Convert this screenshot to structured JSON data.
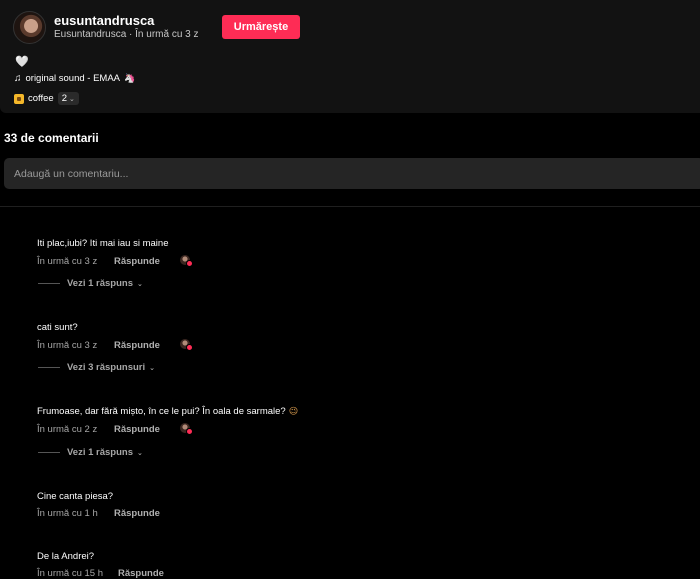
{
  "post": {
    "author_name": "eusuntandrusca",
    "author_meta": "Eusuntandrusca · În urmă cu 3 z",
    "follow_label": "Urmărește",
    "heart_glyph": "🤍",
    "sound_label": "original sound - EMAA",
    "sound_emoji": "🦄",
    "tag_label": "coffee",
    "tag_count": "2"
  },
  "comments_section": {
    "title": "33 de comentarii",
    "input_placeholder": "Adaugă un comentariu..."
  },
  "comments": [
    {
      "text": "Iti plac,iubi? Iti mai iau si maine",
      "time": "În urmă cu 3 z",
      "reply_label": "Răspunde",
      "creator_liked": true,
      "view_replies": "Vezi 1 răspuns"
    },
    {
      "text": "cati sunt?",
      "time": "În urmă cu 3 z",
      "reply_label": "Răspunde",
      "creator_liked": true,
      "view_replies": "Vezi 3 răspunsuri"
    },
    {
      "text": "Frumoase, dar fără mișto, în ce le pui? În oala de sarmale?",
      "emoji": "😉",
      "time": "În urmă cu 2 z",
      "reply_label": "Răspunde",
      "creator_liked": true,
      "view_replies": "Vezi 1 răspuns"
    },
    {
      "text": "Cine canta piesa?",
      "time": "În urmă cu 1 h",
      "reply_label": "Răspunde",
      "creator_liked": false
    },
    {
      "text": "De la Andrei?",
      "time": "În urmă cu 15 h",
      "reply_label": "Răspunde",
      "creator_liked": false
    }
  ],
  "colors": {
    "accent": "#fe2c55",
    "background": "#000000",
    "card": "#121212",
    "input": "#252525"
  }
}
